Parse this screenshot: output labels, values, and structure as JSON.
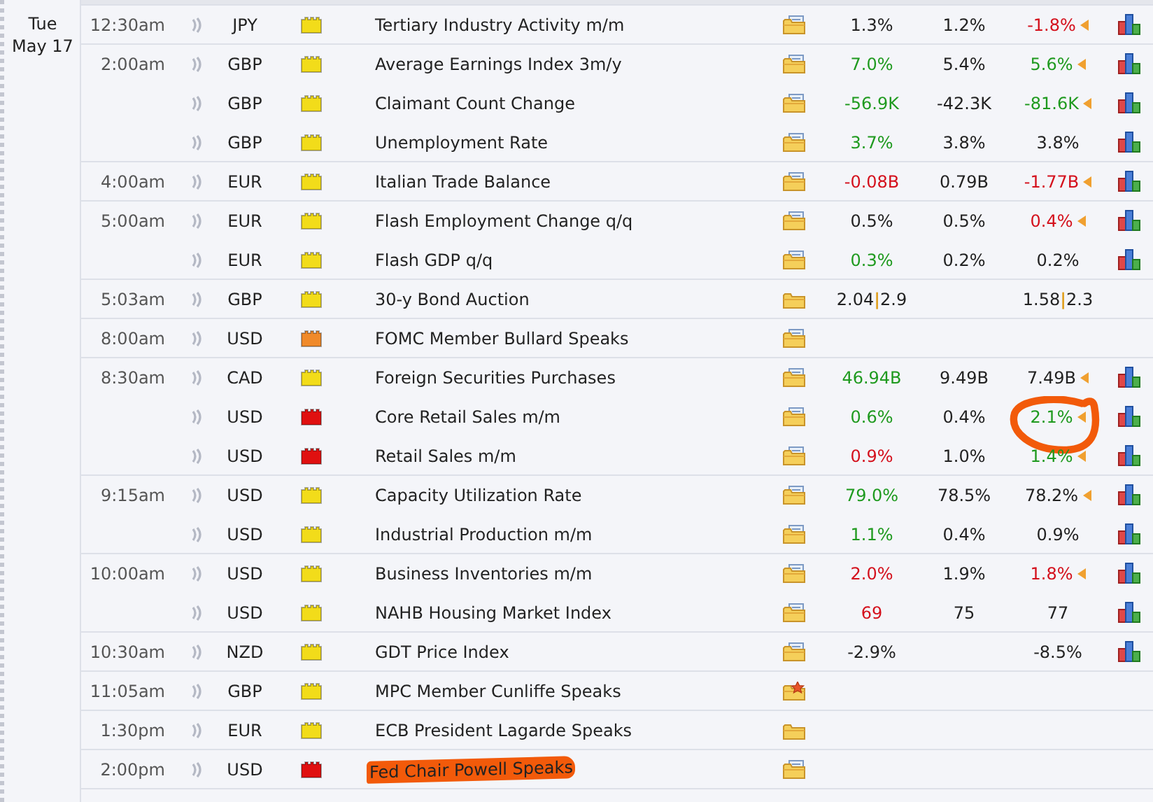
{
  "date": {
    "weekday": "Tue",
    "day": "May 17"
  },
  "rows": [
    {
      "time": "12:30am",
      "currency": "JPY",
      "impact": {
        "color": "#f2dc1a"
      },
      "event": "Tertiary Industry Activity m/m",
      "detail": {
        "kind": "folder-doc"
      },
      "actual": {
        "text": "1.3%",
        "color": "#222222"
      },
      "forecast": "1.2%",
      "previous": {
        "text": "-1.8%",
        "color": "#d4101c"
      },
      "revised": true,
      "graph": true
    },
    {
      "time": "2:00am",
      "currency": "GBP",
      "impact": {
        "color": "#f2dc1a"
      },
      "event": "Average Earnings Index 3m/y",
      "detail": {
        "kind": "folder-doc"
      },
      "actual": {
        "text": "7.0%",
        "color": "#1f9a1f"
      },
      "forecast": "5.4%",
      "previous": {
        "text": "5.6%",
        "color": "#1f9a1f"
      },
      "revised": true,
      "graph": true
    },
    {
      "time": "",
      "currency": "GBP",
      "impact": {
        "color": "#f2dc1a"
      },
      "event": "Claimant Count Change",
      "detail": {
        "kind": "folder-doc"
      },
      "actual": {
        "text": "-56.9K",
        "color": "#1f9a1f"
      },
      "forecast": "-42.3K",
      "previous": {
        "text": "-81.6K",
        "color": "#1f9a1f"
      },
      "revised": true,
      "graph": true
    },
    {
      "time": "",
      "currency": "GBP",
      "impact": {
        "color": "#f2dc1a"
      },
      "event": "Unemployment Rate",
      "detail": {
        "kind": "folder-doc"
      },
      "actual": {
        "text": "3.7%",
        "color": "#1f9a1f"
      },
      "forecast": "3.8%",
      "previous": {
        "text": "3.8%",
        "color": "#222222"
      },
      "revised": false,
      "graph": true
    },
    {
      "time": "4:00am",
      "currency": "EUR",
      "impact": {
        "color": "#f2dc1a"
      },
      "event": "Italian Trade Balance",
      "detail": {
        "kind": "folder-doc"
      },
      "actual": {
        "text": "-0.08B",
        "color": "#d4101c"
      },
      "forecast": "0.79B",
      "previous": {
        "text": "-1.77B",
        "color": "#d4101c"
      },
      "revised": true,
      "graph": true
    },
    {
      "time": "5:00am",
      "currency": "EUR",
      "impact": {
        "color": "#f2dc1a"
      },
      "event": "Flash Employment Change q/q",
      "detail": {
        "kind": "folder-doc"
      },
      "actual": {
        "text": "0.5%",
        "color": "#222222"
      },
      "forecast": "0.5%",
      "previous": {
        "text": "0.4%",
        "color": "#d4101c"
      },
      "revised": true,
      "graph": true
    },
    {
      "time": "",
      "currency": "EUR",
      "impact": {
        "color": "#f2dc1a"
      },
      "event": "Flash GDP q/q",
      "detail": {
        "kind": "folder-doc"
      },
      "actual": {
        "text": "0.3%",
        "color": "#1f9a1f"
      },
      "forecast": "0.2%",
      "previous": {
        "text": "0.2%",
        "color": "#222222"
      },
      "revised": false,
      "graph": true
    },
    {
      "time": "5:03am",
      "currency": "GBP",
      "impact": {
        "color": "#f2dc1a"
      },
      "event": "30-y Bond Auction",
      "detail": {
        "kind": "folder"
      },
      "actual": {
        "text": "2.04|2.9",
        "color": "#222222"
      },
      "previous": {
        "text": "1.58|2.3",
        "color": "#222222"
      },
      "revised": false,
      "graph": false
    },
    {
      "time": "8:00am",
      "currency": "USD",
      "impact": {
        "color": "#f08a2a"
      },
      "event": "FOMC Member Bullard Speaks",
      "detail": {
        "kind": "folder-doc"
      },
      "revised": false,
      "graph": false
    },
    {
      "time": "8:30am",
      "currency": "CAD",
      "impact": {
        "color": "#f2dc1a"
      },
      "event": "Foreign Securities Purchases",
      "detail": {
        "kind": "folder-doc"
      },
      "actual": {
        "text": "46.94B",
        "color": "#1f9a1f"
      },
      "forecast": "9.49B",
      "previous": {
        "text": "7.49B",
        "color": "#222222"
      },
      "revised": true,
      "graph": true
    },
    {
      "time": "",
      "currency": "USD",
      "impact": {
        "color": "#e01010"
      },
      "event": "Core Retail Sales m/m",
      "detail": {
        "kind": "folder-doc"
      },
      "actual": {
        "text": "0.6%",
        "color": "#1f9a1f"
      },
      "forecast": "0.4%",
      "previous": {
        "text": "2.1%",
        "color": "#1f9a1f"
      },
      "revised": true,
      "graph": true,
      "circled": true
    },
    {
      "time": "",
      "currency": "USD",
      "impact": {
        "color": "#e01010"
      },
      "event": "Retail Sales m/m",
      "detail": {
        "kind": "folder-doc"
      },
      "actual": {
        "text": "0.9%",
        "color": "#d4101c"
      },
      "forecast": "1.0%",
      "previous": {
        "text": "1.4%",
        "color": "#1f9a1f"
      },
      "revised": true,
      "graph": true
    },
    {
      "time": "9:15am",
      "currency": "USD",
      "impact": {
        "color": "#f2dc1a"
      },
      "event": "Capacity Utilization Rate",
      "detail": {
        "kind": "folder-doc"
      },
      "actual": {
        "text": "79.0%",
        "color": "#1f9a1f"
      },
      "forecast": "78.5%",
      "previous": {
        "text": "78.2%",
        "color": "#222222"
      },
      "revised": true,
      "graph": true
    },
    {
      "time": "",
      "currency": "USD",
      "impact": {
        "color": "#f2dc1a"
      },
      "event": "Industrial Production m/m",
      "detail": {
        "kind": "folder-doc"
      },
      "actual": {
        "text": "1.1%",
        "color": "#1f9a1f"
      },
      "forecast": "0.4%",
      "previous": {
        "text": "0.9%",
        "color": "#222222"
      },
      "revised": false,
      "graph": true
    },
    {
      "time": "10:00am",
      "currency": "USD",
      "impact": {
        "color": "#f2dc1a"
      },
      "event": "Business Inventories m/m",
      "detail": {
        "kind": "folder-doc"
      },
      "actual": {
        "text": "2.0%",
        "color": "#d4101c"
      },
      "forecast": "1.9%",
      "previous": {
        "text": "1.8%",
        "color": "#d4101c"
      },
      "revised": true,
      "graph": true
    },
    {
      "time": "",
      "currency": "USD",
      "impact": {
        "color": "#f2dc1a"
      },
      "event": "NAHB Housing Market Index",
      "detail": {
        "kind": "folder-doc"
      },
      "actual": {
        "text": "69",
        "color": "#d4101c"
      },
      "forecast": "75",
      "previous": {
        "text": "77",
        "color": "#222222"
      },
      "revised": false,
      "graph": true
    },
    {
      "time": "10:30am",
      "currency": "NZD",
      "impact": {
        "color": "#f2dc1a"
      },
      "event": "GDT Price Index",
      "detail": {
        "kind": "folder-doc"
      },
      "actual": {
        "text": "-2.9%",
        "color": "#222222"
      },
      "previous": {
        "text": "-8.5%",
        "color": "#222222"
      },
      "revised": false,
      "graph": true
    },
    {
      "time": "11:05am",
      "currency": "GBP",
      "impact": {
        "color": "#f2dc1a"
      },
      "event": "MPC Member Cunliffe Speaks",
      "detail": {
        "kind": "folder-star"
      },
      "revised": false,
      "graph": false
    },
    {
      "time": "1:30pm",
      "currency": "EUR",
      "impact": {
        "color": "#f2dc1a"
      },
      "event": "ECB President Lagarde Speaks",
      "detail": {
        "kind": "folder"
      },
      "revised": false,
      "graph": false
    },
    {
      "time": "2:00pm",
      "currency": "USD",
      "impact": {
        "color": "#e01010"
      },
      "event": "Fed Chair Powell Speaks",
      "detail": {
        "kind": "folder-doc"
      },
      "revised": false,
      "graph": false,
      "highlighted": true
    }
  ]
}
